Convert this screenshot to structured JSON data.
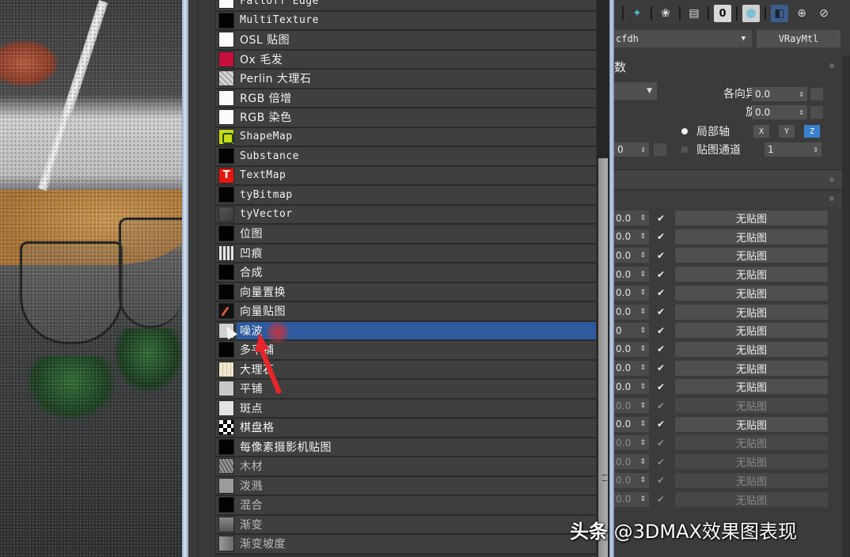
{
  "map_browser": {
    "items": [
      {
        "label": "Falloff Edge",
        "swatch": "white",
        "cjk": false
      },
      {
        "label": "MultiTexture",
        "swatch": "black",
        "cjk": false
      },
      {
        "label": "OSL 贴图",
        "swatch": "white",
        "cjk": true
      },
      {
        "label": "Ox 毛发",
        "swatch": "crimson",
        "cjk": true
      },
      {
        "label": "Perlin 大理石",
        "swatch": "perlin",
        "cjk": true
      },
      {
        "label": "RGB 倍增",
        "swatch": "white",
        "cjk": true
      },
      {
        "label": "RGB 染色",
        "swatch": "white",
        "cjk": true
      },
      {
        "label": "ShapeMap",
        "swatch": "shape",
        "cjk": false
      },
      {
        "label": "Substance",
        "swatch": "black",
        "cjk": false
      },
      {
        "label": "TextMap",
        "swatch": "text",
        "cjk": false
      },
      {
        "label": "tyBitmap",
        "swatch": "black",
        "cjk": false
      },
      {
        "label": "tyVector",
        "swatch": "vector",
        "cjk": false
      },
      {
        "label": "位图",
        "swatch": "black",
        "cjk": true
      },
      {
        "label": "凹痕",
        "swatch": "dents",
        "cjk": true
      },
      {
        "label": "合成",
        "swatch": "black",
        "cjk": true
      },
      {
        "label": "向量置换",
        "swatch": "black",
        "cjk": true
      },
      {
        "label": "向量贴图",
        "swatch": "vmap",
        "cjk": true
      },
      {
        "label": "噪波",
        "swatch": "noise",
        "cjk": true,
        "selected": true
      },
      {
        "label": "多平铺",
        "swatch": "black",
        "cjk": true
      },
      {
        "label": "大理石",
        "swatch": "marble",
        "cjk": true
      },
      {
        "label": "平铺",
        "swatch": "tiles",
        "cjk": true
      },
      {
        "label": "斑点",
        "swatch": "speckle",
        "cjk": true
      },
      {
        "label": "棋盘格",
        "swatch": "checker",
        "cjk": true
      },
      {
        "label": "每像素摄影机贴图",
        "swatch": "black",
        "cjk": true
      },
      {
        "label": "木材",
        "swatch": "wood",
        "cjk": true
      },
      {
        "label": "泼溅",
        "swatch": "splat",
        "cjk": true
      },
      {
        "label": "混合",
        "swatch": "black",
        "cjk": true
      },
      {
        "label": "渐变",
        "swatch": "gradient",
        "cjk": true
      },
      {
        "label": "渐变坡度",
        "swatch": "gradramp",
        "cjk": true
      }
    ],
    "selected_color": "#2d5b9d"
  },
  "toolbar": {
    "icons": [
      "sparkle-icon",
      "material-sphere-icon",
      "clipboard-icon",
      "material-id-icon",
      "show-map-icon",
      "show-background-icon",
      "magnify-icon",
      "pick-icon"
    ],
    "material_id": "0"
  },
  "material": {
    "name": "cfdh",
    "type_button": "VRayMtl"
  },
  "params": {
    "rollout_title": "数",
    "anisotropy_label": "各向异性",
    "anisotropy_value": "0.0",
    "rotation_label": "旋转",
    "rotation_value": "0.0",
    "local_axis_label": "局部轴",
    "axes": [
      "X",
      "Y",
      "Z"
    ],
    "active_axis": "Z",
    "map_channel_label": "贴图通道",
    "map_channel_value": "1",
    "left_spinner_value": "0"
  },
  "maps": {
    "no_map_label": "无贴图",
    "slots": [
      {
        "amount": "0.0",
        "enabled": true,
        "dim": false
      },
      {
        "amount": "0.0",
        "enabled": true,
        "dim": false
      },
      {
        "amount": "0.0",
        "enabled": true,
        "dim": false
      },
      {
        "amount": "0.0",
        "enabled": true,
        "dim": false
      },
      {
        "amount": "0.0",
        "enabled": true,
        "dim": false
      },
      {
        "amount": "0.0",
        "enabled": true,
        "dim": false
      },
      {
        "amount": "0",
        "enabled": true,
        "dim": false
      },
      {
        "amount": "0.0",
        "enabled": true,
        "dim": false
      },
      {
        "amount": "0.0",
        "enabled": true,
        "dim": false
      },
      {
        "amount": "0.0",
        "enabled": true,
        "dim": false
      },
      {
        "amount": "0.0",
        "enabled": true,
        "dim": true
      },
      {
        "amount": "0.0",
        "enabled": true,
        "dim": false
      },
      {
        "amount": "0.0",
        "enabled": true,
        "dim": true
      },
      {
        "amount": "0.0",
        "enabled": true,
        "dim": true
      },
      {
        "amount": "0.0",
        "enabled": true,
        "dim": true
      },
      {
        "amount": "0.0",
        "enabled": true,
        "dim": true
      }
    ]
  },
  "watermark": {
    "prefix": "头条",
    "handle": "@3DMAX效果图表现"
  }
}
